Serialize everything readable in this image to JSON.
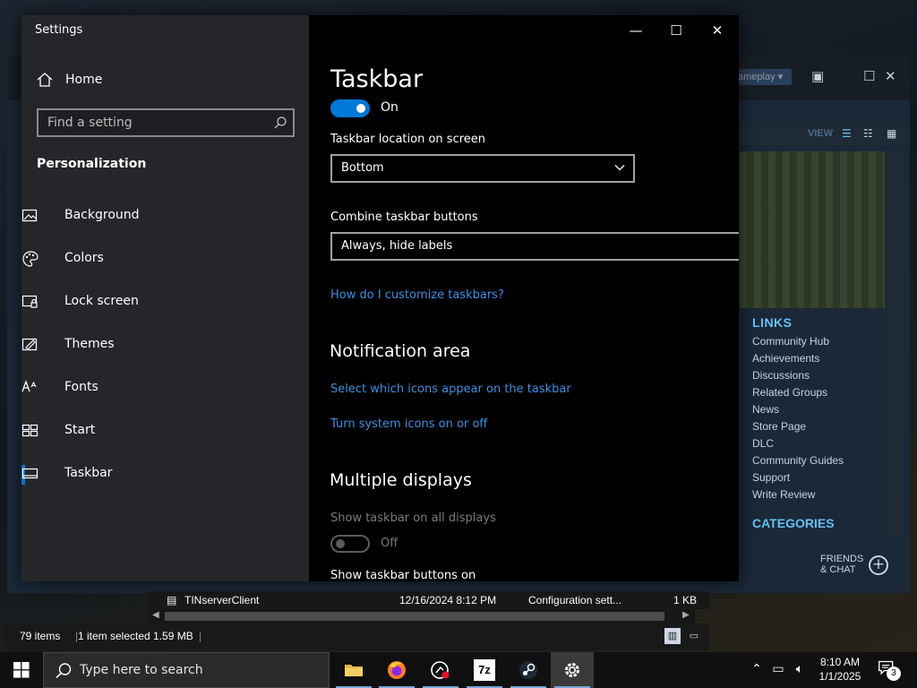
{
  "steam": {
    "view_dropdown": "ameplay ▾",
    "view_label": "VIEW",
    "links_header": "LINKS",
    "links": [
      "Community Hub",
      "Achievements",
      "Discussions",
      "Related Groups",
      "News",
      "Store Page",
      "DLC",
      "Community Guides",
      "Support",
      "Write Review"
    ],
    "categories_header": "CATEGORIES",
    "friends_line1": "FRIENDS",
    "friends_line2": "& CHAT"
  },
  "explorer": {
    "file_name": "TINserverClient",
    "file_date": "12/16/2024 8:12 PM",
    "file_type": "Configuration sett...",
    "file_size": "1 KB",
    "status_items": "79 items",
    "status_selected": "1 item selected  1.59 MB"
  },
  "settings": {
    "app_title": "Settings",
    "home_label": "Home",
    "search_placeholder": "Find a setting",
    "section_header": "Personalization",
    "nav": [
      {
        "label": "Background",
        "icon": "image-icon"
      },
      {
        "label": "Colors",
        "icon": "palette-icon"
      },
      {
        "label": "Lock screen",
        "icon": "lock-screen-icon"
      },
      {
        "label": "Themes",
        "icon": "themes-icon"
      },
      {
        "label": "Fonts",
        "icon": "fonts-icon"
      },
      {
        "label": "Start",
        "icon": "start-icon"
      },
      {
        "label": "Taskbar",
        "icon": "taskbar-icon",
        "active": true
      }
    ],
    "page_title": "Taskbar",
    "lock_toggle_state": "On",
    "location_label": "Taskbar location on screen",
    "location_value": "Bottom",
    "combine_label": "Combine taskbar buttons",
    "combine_value": "Always, hide labels",
    "customize_link": "How do I customize taskbars?",
    "notification_header": "Notification area",
    "select_icons_link": "Select which icons appear on the taskbar",
    "system_icons_link": "Turn system icons on or off",
    "multiple_displays_header": "Multiple displays",
    "show_all_label": "Show taskbar on all displays",
    "show_all_state": "Off",
    "show_buttons_label": "Show taskbar buttons on"
  },
  "taskbar": {
    "search_placeholder": "Type here to search",
    "time": "8:10 AM",
    "date": "1/1/2025",
    "notification_count": "3",
    "apps": [
      "file-explorer-icon",
      "firefox-icon",
      "recorder-icon",
      "7zip-icon",
      "steam-icon",
      "settings-gear-icon"
    ],
    "sevenzip_label": "7z"
  },
  "colors": {
    "accent": "#0078d7",
    "link": "#3a8fe0",
    "steam_link": "#66c0f4"
  }
}
